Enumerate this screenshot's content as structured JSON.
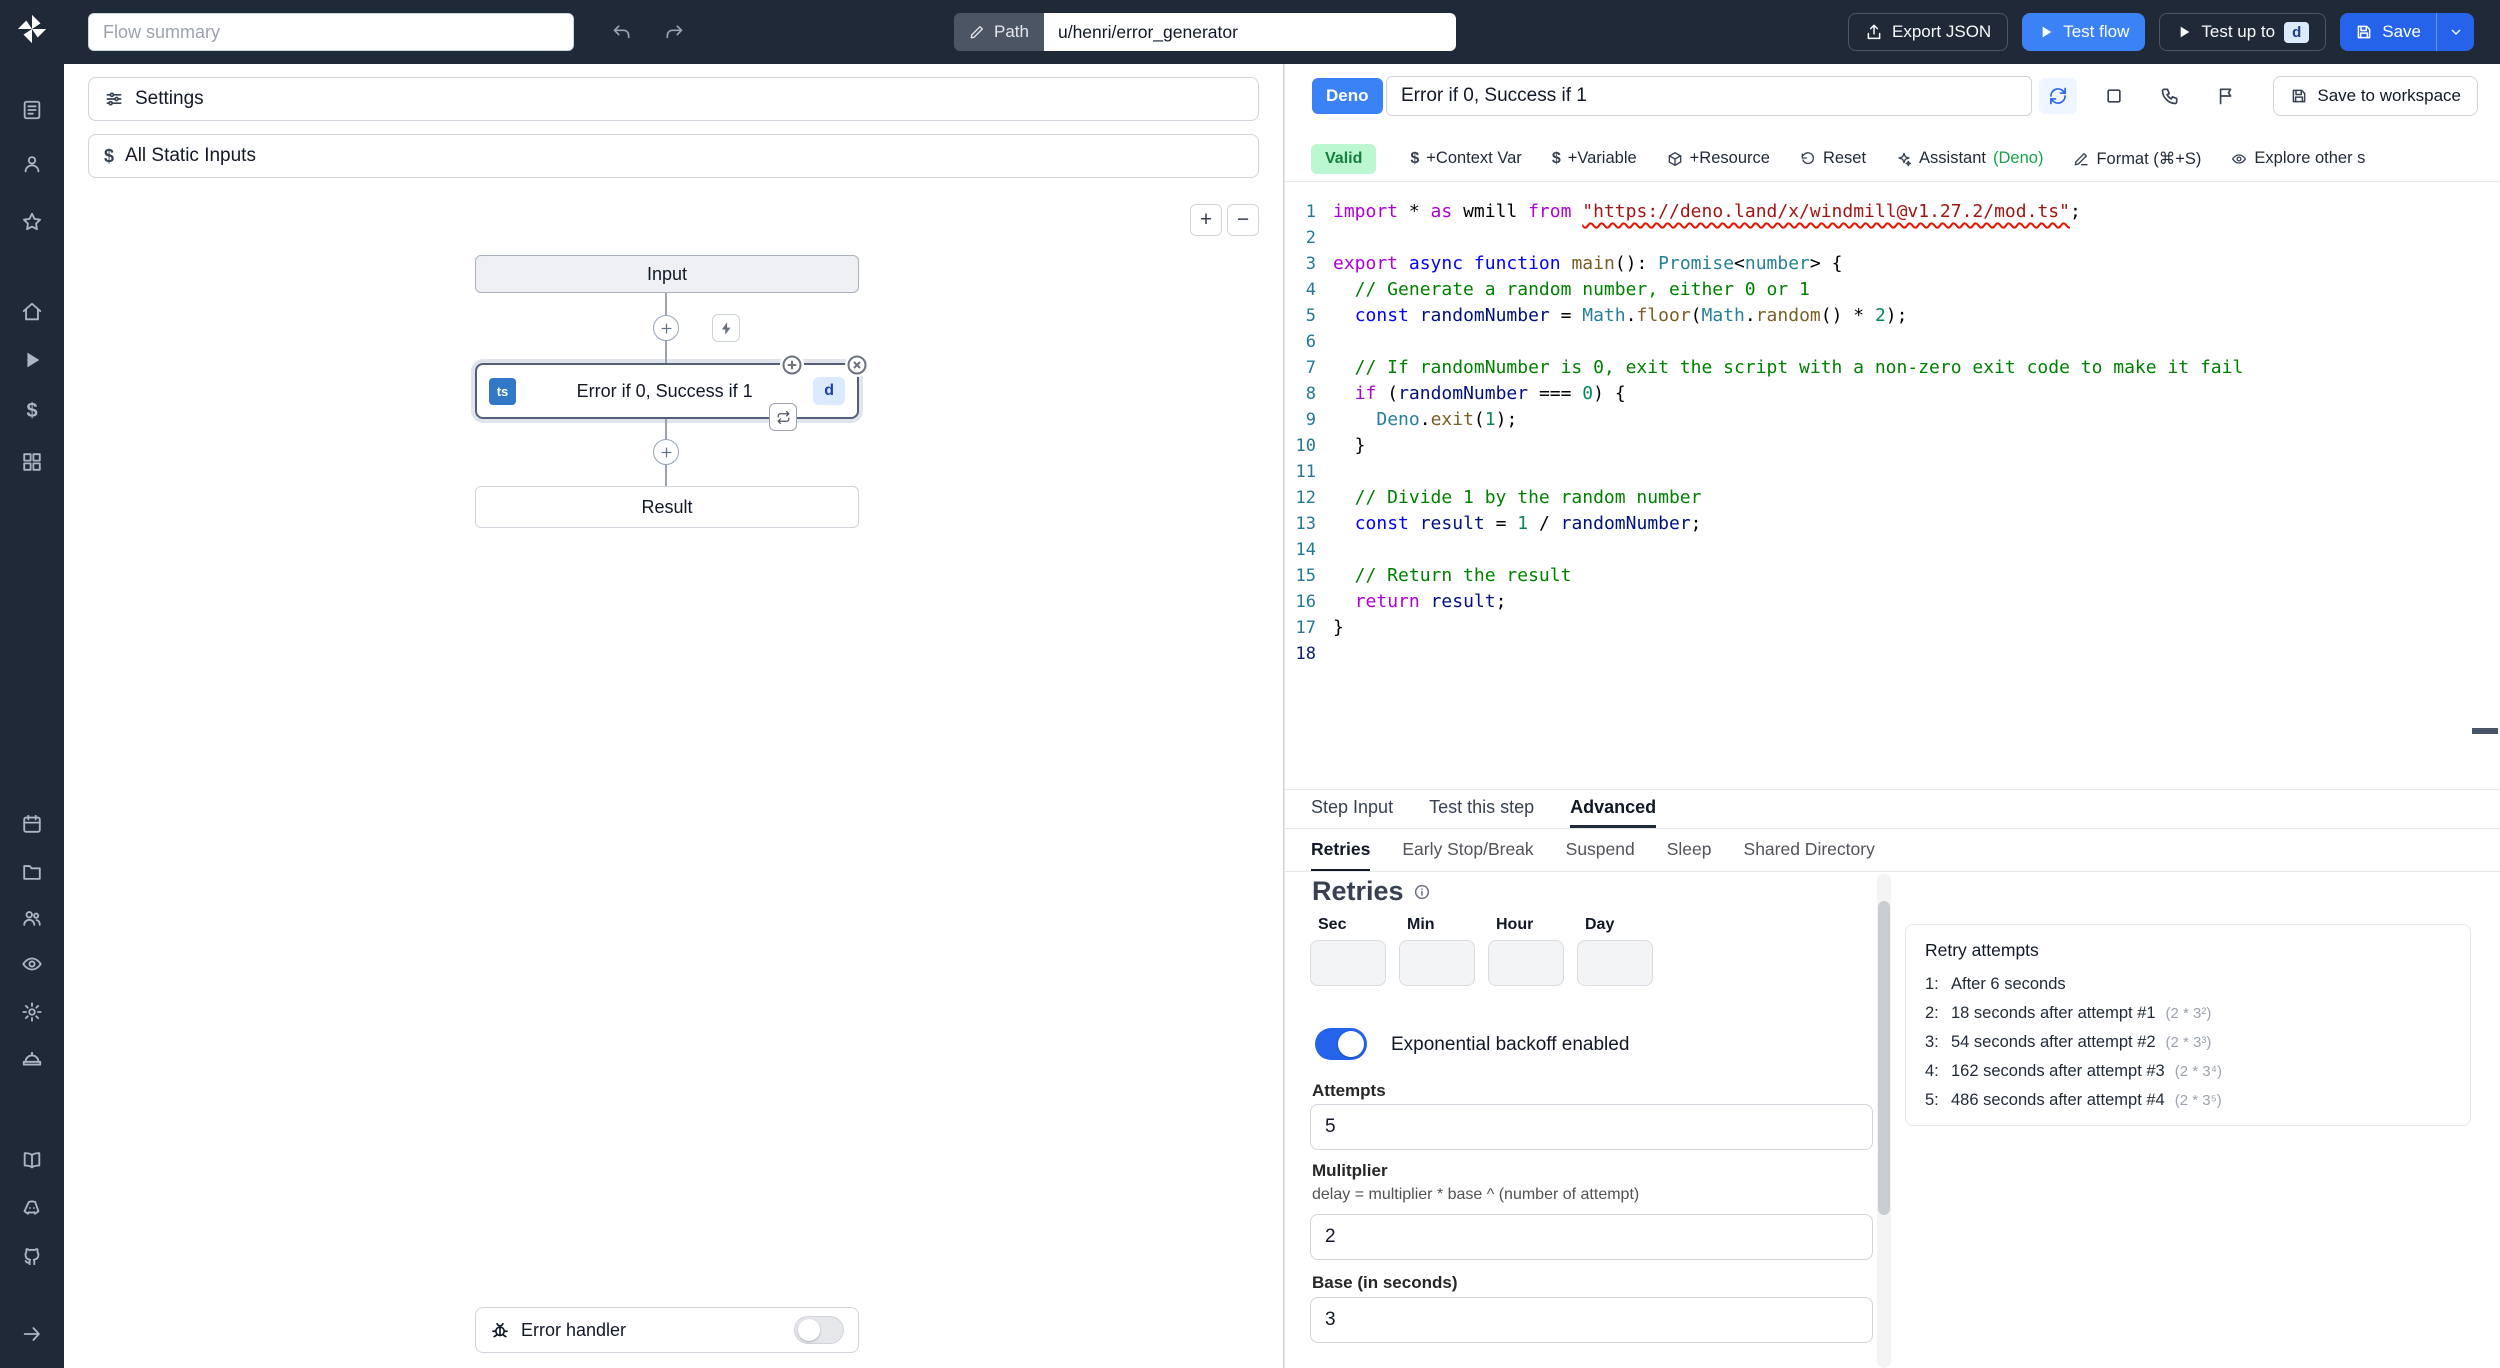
{
  "topbar": {
    "flow_summary_placeholder": "Flow summary",
    "path_label": "Path",
    "path_value": "u/henri/error_generator",
    "export_json_label": "Export JSON",
    "test_flow_label": "Test flow",
    "test_up_to_label": "Test up to",
    "test_up_to_badge": "d",
    "save_label": "Save"
  },
  "sidebar": {
    "icons": [
      "list-icon",
      "user-icon",
      "star-icon",
      "home-icon",
      "play-icon",
      "dollar-icon",
      "grid-icon",
      "calendar-icon",
      "folder-icon",
      "users-icon",
      "eye-icon",
      "gear-icon",
      "worker-icon",
      "book-icon",
      "discord-icon",
      "github-icon"
    ]
  },
  "flow_panel": {
    "settings_label": "Settings",
    "static_inputs_label": "All Static Inputs",
    "zoom_in_label": "+",
    "zoom_out_label": "−",
    "input_node_label": "Input",
    "step": {
      "lang_badge": "ts",
      "label": "Error if 0, Success if 1",
      "id_badge": "d"
    },
    "result_node_label": "Result",
    "error_handler_label": "Error handler"
  },
  "editor": {
    "lang_badge": "Deno",
    "step_title": "Error if 0, Success if 1",
    "save_to_workspace_label": "Save to workspace",
    "toolbar": {
      "valid_label": "Valid",
      "context_var_label": "+Context Var",
      "variable_label": "+Variable",
      "resource_label": "+Resource",
      "reset_label": "Reset",
      "assistant_label": "Assistant",
      "assistant_lang": "(Deno)",
      "format_label": "Format (⌘+S)",
      "explore_label": "Explore other s"
    },
    "code_lines": [
      [
        [
          "kp",
          "import"
        ],
        [
          "pl",
          " * "
        ],
        [
          "kp",
          "as"
        ],
        [
          "pl",
          " wmill "
        ],
        [
          "kp",
          "from"
        ],
        [
          "pl",
          " "
        ],
        [
          "se",
          "\"https://deno.land/x/windmill@v1.27.2/mod.ts\""
        ],
        [
          "pl",
          ";"
        ]
      ],
      [],
      [
        [
          "kp",
          "export"
        ],
        [
          "pl",
          " "
        ],
        [
          "kb",
          "async"
        ],
        [
          "pl",
          " "
        ],
        [
          "kb",
          "function"
        ],
        [
          "pl",
          " "
        ],
        [
          "fn",
          "main"
        ],
        [
          "pl",
          "(): "
        ],
        [
          "ty",
          "Promise"
        ],
        [
          "pl",
          "<"
        ],
        [
          "ty",
          "number"
        ],
        [
          "pl",
          "> {"
        ]
      ],
      [
        [
          "cm",
          "  // Generate a random number, either 0 or 1"
        ]
      ],
      [
        [
          "pl",
          "  "
        ],
        [
          "kb",
          "const"
        ],
        [
          "pl",
          " "
        ],
        [
          "vr",
          "randomNumber"
        ],
        [
          "pl",
          " = "
        ],
        [
          "ty",
          "Math"
        ],
        [
          "pl",
          "."
        ],
        [
          "fn",
          "floor"
        ],
        [
          "pl",
          "("
        ],
        [
          "ty",
          "Math"
        ],
        [
          "pl",
          "."
        ],
        [
          "fn",
          "random"
        ],
        [
          "pl",
          "() * "
        ],
        [
          "nu",
          "2"
        ],
        [
          "pl",
          ");"
        ]
      ],
      [],
      [
        [
          "cm",
          "  // If randomNumber is 0, exit the script with a non-zero exit code to make it fail"
        ]
      ],
      [
        [
          "pl",
          "  "
        ],
        [
          "kp",
          "if"
        ],
        [
          "pl",
          " ("
        ],
        [
          "vr",
          "randomNumber"
        ],
        [
          "pl",
          " === "
        ],
        [
          "nu",
          "0"
        ],
        [
          "pl",
          ") {"
        ]
      ],
      [
        [
          "pl",
          "    "
        ],
        [
          "ty",
          "Deno"
        ],
        [
          "pl",
          "."
        ],
        [
          "fn",
          "exit"
        ],
        [
          "pl",
          "("
        ],
        [
          "nu",
          "1"
        ],
        [
          "pl",
          ");"
        ]
      ],
      [
        [
          "pl",
          "  }"
        ]
      ],
      [],
      [
        [
          "cm",
          "  // Divide 1 by the random number"
        ]
      ],
      [
        [
          "pl",
          "  "
        ],
        [
          "kb",
          "const"
        ],
        [
          "pl",
          " "
        ],
        [
          "vr",
          "result"
        ],
        [
          "pl",
          " = "
        ],
        [
          "nu",
          "1"
        ],
        [
          "pl",
          " / "
        ],
        [
          "vr",
          "randomNumber"
        ],
        [
          "pl",
          ";"
        ]
      ],
      [],
      [
        [
          "cm",
          "  // Return the result"
        ]
      ],
      [
        [
          "pl",
          "  "
        ],
        [
          "kp",
          "return"
        ],
        [
          "pl",
          " "
        ],
        [
          "vr",
          "result"
        ],
        [
          "pl",
          ";"
        ]
      ],
      [
        [
          "pl",
          "}"
        ]
      ],
      []
    ]
  },
  "bottom_panel": {
    "tabs": {
      "step_input": "Step Input",
      "test_step": "Test this step",
      "advanced": "Advanced"
    },
    "subtabs": {
      "retries": "Retries",
      "early_stop": "Early Stop/Break",
      "suspend": "Suspend",
      "sleep": "Sleep",
      "shared_dir": "Shared Directory"
    },
    "retries": {
      "heading": "Retries",
      "time_labels": [
        "Sec",
        "Min",
        "Hour",
        "Day"
      ],
      "backoff_label": "Exponential backoff enabled",
      "attempts_label": "Attempts",
      "attempts_value": "5",
      "multiplier_label": "Mulitplier",
      "multiplier_help": "delay = multiplier * base ^ (number of attempt)",
      "multiplier_value": "2",
      "base_label": "Base (in seconds)",
      "base_value": "3",
      "panel_title": "Retry attempts",
      "attempts_list": [
        {
          "n": "1:",
          "text": "After 6 seconds",
          "formula": ""
        },
        {
          "n": "2:",
          "text": "18 seconds after attempt #1",
          "formula": "(2 * 3²)"
        },
        {
          "n": "3:",
          "text": "54 seconds after attempt #2",
          "formula": "(2 * 3³)"
        },
        {
          "n": "4:",
          "text": "162 seconds after attempt #3",
          "formula": "(2 * 3⁴)"
        },
        {
          "n": "5:",
          "text": "486 seconds after attempt #4",
          "formula": "(2 * 3⁵)"
        }
      ]
    }
  }
}
